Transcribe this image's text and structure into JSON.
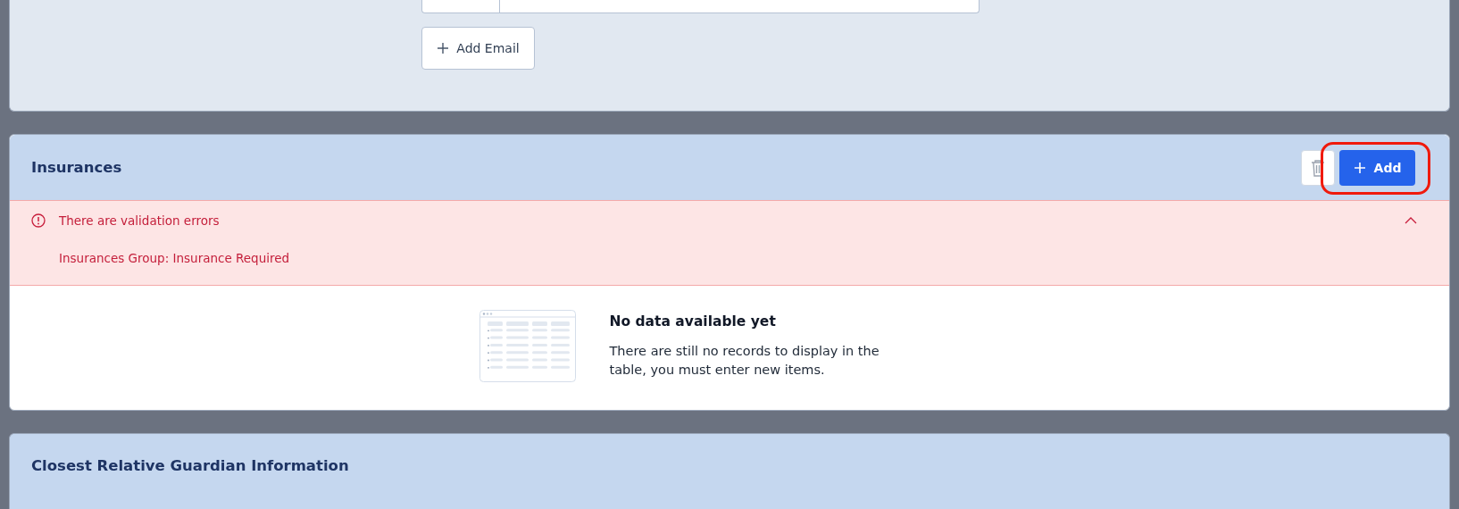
{
  "email_section": {
    "add_button": "Add Email"
  },
  "insurances": {
    "title": "Insurances",
    "add_button": "Add",
    "highlighted": true,
    "validation": {
      "title": "There are validation errors",
      "expanded": true,
      "messages": [
        "Insurances Group: Insurance Required"
      ]
    },
    "empty_state": {
      "title": "No data available yet",
      "text": "There are still no records to display in the table, you must enter new items."
    }
  },
  "guardian": {
    "title": "Closest Relative Guardian Information"
  }
}
